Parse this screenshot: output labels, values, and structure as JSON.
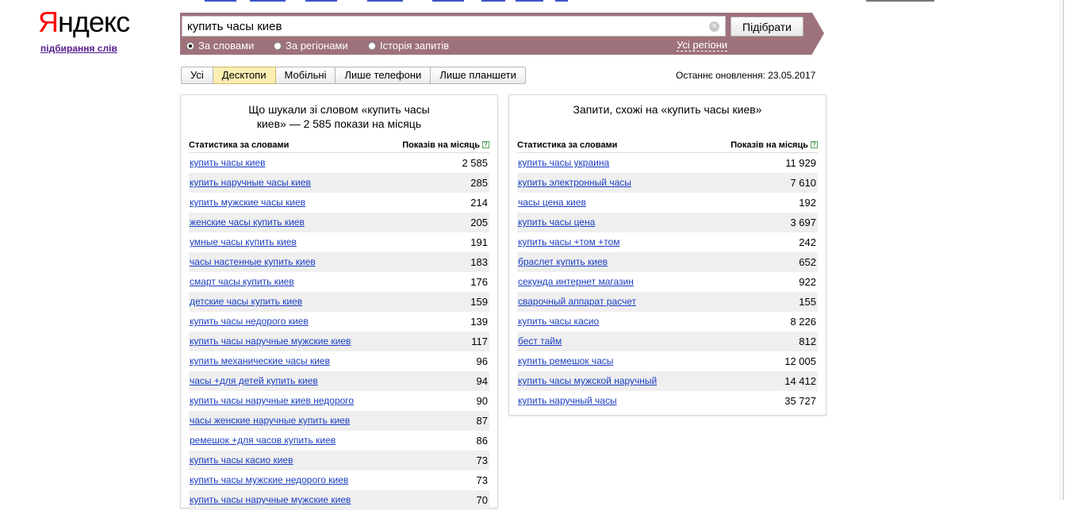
{
  "logo": {
    "text": "Яндекс",
    "first_letter": "Я",
    "rest": "ндекс",
    "subtitle": "підбирання слів"
  },
  "search": {
    "query": "купить часы киев",
    "submit_label": "Підібрати",
    "modes": [
      {
        "label": "За словами",
        "checked": true
      },
      {
        "label": "За регіонами",
        "checked": false
      },
      {
        "label": "Історія запитів",
        "checked": false
      }
    ],
    "regions_link": "Усі регіони"
  },
  "tabs": [
    {
      "label": "Усі",
      "active": false
    },
    {
      "label": "Десктопи",
      "active": true
    },
    {
      "label": "Мобільні",
      "active": false
    },
    {
      "label": "Лише телефони",
      "active": false
    },
    {
      "label": "Лише планшети",
      "active": false
    }
  ],
  "updated": "Останнє оновлення: 23.05.2017",
  "left": {
    "title_line1": "Що шукали зі словом «купить часы",
    "title_line2": "киев» — 2 585 покази на місяць",
    "col1": "Статистика за словами",
    "col2": "Показів на місяць",
    "rows": [
      {
        "q": "купить часы киев",
        "n": "2 585"
      },
      {
        "q": "купить наручные часы киев",
        "n": "285"
      },
      {
        "q": "купить мужские часы киев",
        "n": "214"
      },
      {
        "q": "женские часы купить киев",
        "n": "205"
      },
      {
        "q": "умные часы купить киев",
        "n": "191"
      },
      {
        "q": "часы настенные купить киев",
        "n": "183"
      },
      {
        "q": "смарт часы купить киев",
        "n": "176"
      },
      {
        "q": "детские часы купить киев",
        "n": "159"
      },
      {
        "q": "купить часы недорого киев",
        "n": "139"
      },
      {
        "q": "купить часы наручные мужские киев",
        "n": "117"
      },
      {
        "q": "купить механические часы киев",
        "n": "96"
      },
      {
        "q": "часы +для детей купить киев",
        "n": "94"
      },
      {
        "q": "купить часы наручные киев недорого",
        "n": "90"
      },
      {
        "q": "часы женские наручные купить киев",
        "n": "87"
      },
      {
        "q": "ремешок +для часов купить киев",
        "n": "86"
      },
      {
        "q": "купить часы касио киев",
        "n": "73"
      },
      {
        "q": "купить часы мужские недорого киев",
        "n": "73"
      },
      {
        "q": "купить часы наручные мужские киев",
        "n": "70"
      }
    ]
  },
  "right": {
    "title": "Запити, схожі на «купить часы киев»",
    "col1": "Статистика за словами",
    "col2": "Показів на місяць",
    "rows": [
      {
        "q": "купить часы украина",
        "n": "11 929"
      },
      {
        "q": "купить электронный часы",
        "n": "7 610"
      },
      {
        "q": "часы цена киев",
        "n": "192"
      },
      {
        "q": "купить часы цена",
        "n": "3 697"
      },
      {
        "q": "купить часы +том +том",
        "n": "242"
      },
      {
        "q": "браслет купить киев",
        "n": "652"
      },
      {
        "q": "секунда интернет магазин",
        "n": "922"
      },
      {
        "q": "сварочный аппарат расчет",
        "n": "155"
      },
      {
        "q": "купить часы касио",
        "n": "8 226"
      },
      {
        "q": "бест тайм",
        "n": "812"
      },
      {
        "q": "купить ремешок часы",
        "n": "12 005"
      },
      {
        "q": "купить часы мужской наручный",
        "n": "14 412"
      },
      {
        "q": "купить наручный часы",
        "n": "35 727"
      }
    ]
  }
}
